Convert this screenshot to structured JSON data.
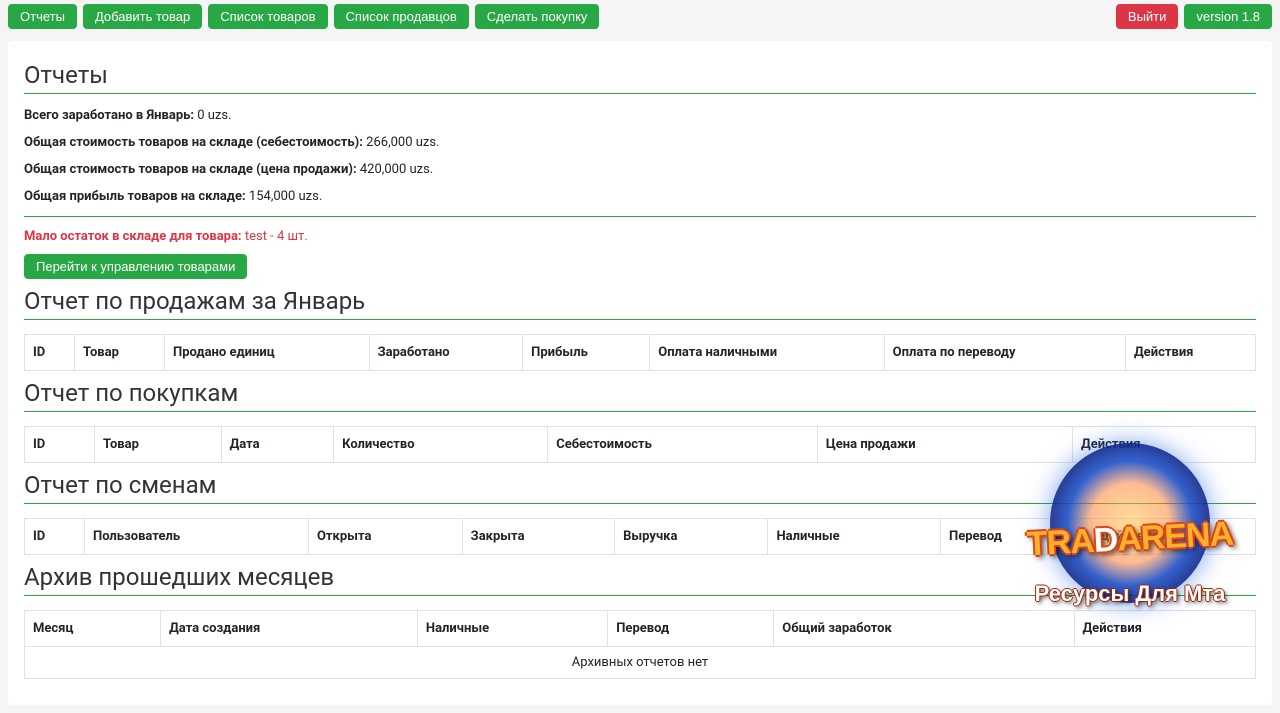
{
  "nav": {
    "reports": "Отчеты",
    "add_product": "Добавить товар",
    "product_list": "Список товаров",
    "seller_list": "Список продавцов",
    "make_purchase": "Сделать покупку",
    "logout": "Выйти",
    "version": "version 1.8"
  },
  "page_title": "Отчеты",
  "stats": {
    "earned_label": "Всего заработано в Январь:",
    "earned_value": " 0 uzs.",
    "warehouse_cost_label": "Общая стоимость товаров на складе (себестоимость):",
    "warehouse_cost_value": " 266,000 uzs.",
    "warehouse_sale_label": "Общая стоимость товаров на складе (цена продажи):",
    "warehouse_sale_value": " 420,000 uzs.",
    "warehouse_profit_label": "Общая прибыль товаров на складе:",
    "warehouse_profit_value": " 154,000 uzs."
  },
  "warning": {
    "label": "Мало остаток в складе для товара: ",
    "value": "test - 4 шт."
  },
  "manage_btn": "Перейти к управлению товарами",
  "sales_report": {
    "title": "Отчет по продажам за Январь",
    "headers": {
      "id": "ID",
      "product": "Товар",
      "sold": "Продано единиц",
      "earned": "Заработано",
      "profit": "Прибыль",
      "cash": "Оплата наличными",
      "transfer": "Оплата по переводу",
      "actions": "Действия"
    }
  },
  "purchase_report": {
    "title": "Отчет по покупкам",
    "headers": {
      "id": "ID",
      "product": "Товар",
      "date": "Дата",
      "qty": "Количество",
      "cost": "Себестоимость",
      "sale_price": "Цена продажи",
      "actions": "Действия"
    }
  },
  "shift_report": {
    "title": "Отчет по сменам",
    "headers": {
      "id": "ID",
      "user": "Пользователь",
      "opened": "Открыта",
      "closed": "Закрыта",
      "revenue": "Выручка",
      "cash": "Наличные",
      "transfer": "Перевод",
      "actions": "Действия"
    }
  },
  "archive": {
    "title": "Архив прошедших месяцев",
    "headers": {
      "month": "Месяц",
      "created": "Дата создания",
      "cash": "Наличные",
      "transfer": "Перевод",
      "total": "Общий заработок",
      "actions": "Действия"
    },
    "empty": "Архивных отчетов нет"
  },
  "logo": {
    "main": "TRADARENA",
    "sub": "Ресурсы Для Мта"
  }
}
